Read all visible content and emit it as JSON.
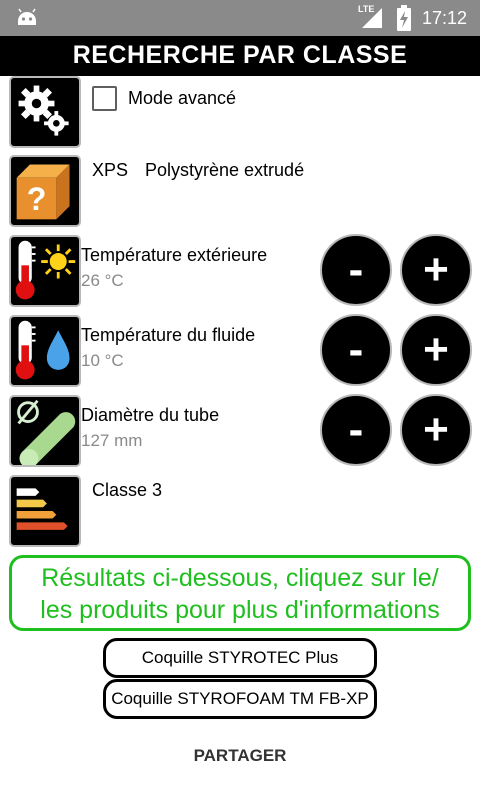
{
  "status_bar": {
    "network": "LTE",
    "time": "17:12"
  },
  "header": {
    "title": "RECHERCHE PAR CLASSE"
  },
  "settings": {
    "mode_label": "Mode avancé",
    "checked": false
  },
  "material": {
    "code": "XPS",
    "name": "Polystyrène extrudé"
  },
  "params": [
    {
      "label": "Température extérieure",
      "value": "26 °C"
    },
    {
      "label": "Température du fluide",
      "value": "10 °C"
    },
    {
      "label": "Diamètre du tube",
      "value": "127 mm"
    }
  ],
  "controls": {
    "minus": "-",
    "plus": "+"
  },
  "energy_class": {
    "label": "Classe 3"
  },
  "results": {
    "line1": "Résultats ci-dessous, cliquez sur le/",
    "line2": "les produits pour plus d'informations"
  },
  "products": [
    "Coquille STYROTEC Plus",
    "Coquille STYROFOAM TM FB-XP"
  ],
  "footer": {
    "share_label": "PARTAGER"
  },
  "colors": {
    "status_bar": "#8a8a8a",
    "title_bar": "#000000",
    "accent_green": "#1fbf1f",
    "value_gray": "#8a8a8a"
  }
}
